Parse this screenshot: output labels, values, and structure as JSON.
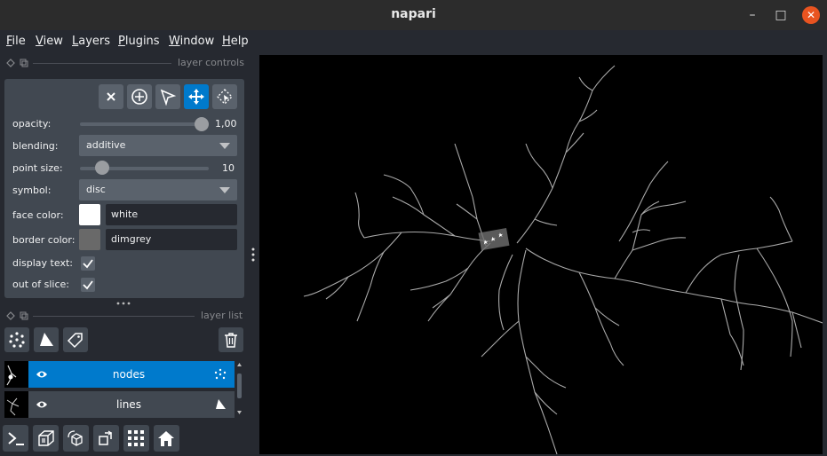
{
  "window": {
    "title": "napari"
  },
  "menubar": {
    "items": [
      {
        "label": "File",
        "u": "F",
        "rest": "ile"
      },
      {
        "label": "View",
        "u": "V",
        "rest": "iew"
      },
      {
        "label": "Layers",
        "u": "L",
        "rest": "ayers"
      },
      {
        "label": "Plugins",
        "u": "P",
        "rest": "lugins"
      },
      {
        "label": "Window",
        "u": "W",
        "rest": "indow"
      },
      {
        "label": "Help",
        "u": "H",
        "rest": "elp"
      }
    ]
  },
  "layer_controls": {
    "header": "layer controls",
    "opacity": {
      "label": "opacity:",
      "value": "1,00",
      "fraction": 1.0
    },
    "blending": {
      "label": "blending:",
      "value": "additive"
    },
    "point_size": {
      "label": "point size:",
      "value": "10",
      "fraction": 0.13
    },
    "symbol": {
      "label": "symbol:",
      "value": "disc"
    },
    "face_color": {
      "label": "face color:",
      "value": "white",
      "swatch": "#ffffff"
    },
    "border_color": {
      "label": "border color:",
      "value": "dimgrey",
      "swatch": "#696969"
    },
    "display_text": {
      "label": "display text:",
      "checked": true
    },
    "out_of_slice": {
      "label": "out of slice:",
      "checked": true
    }
  },
  "layer_list": {
    "header": "layer list",
    "layers": [
      {
        "name": "nodes",
        "type": "points",
        "selected": true
      },
      {
        "name": "lines",
        "type": "shapes",
        "selected": false
      }
    ]
  },
  "colors": {
    "accent": "#007acc",
    "panel": "#414851",
    "background": "#262930"
  }
}
